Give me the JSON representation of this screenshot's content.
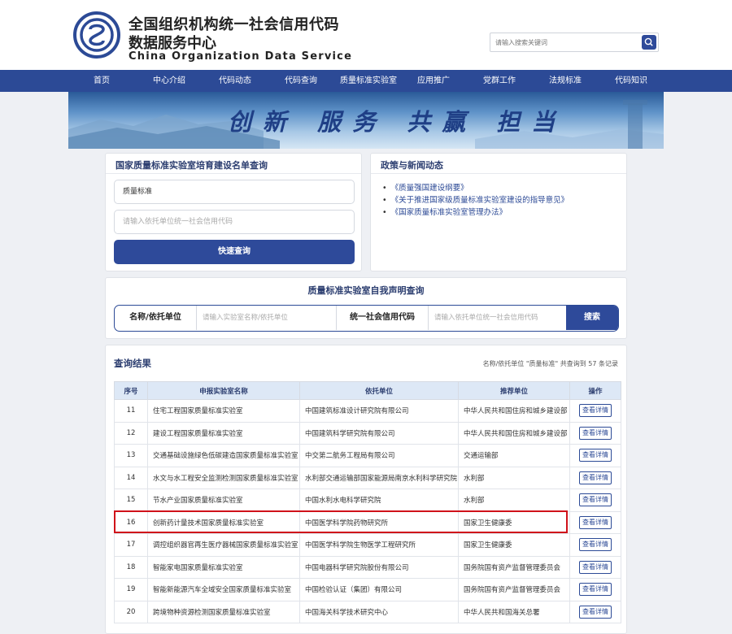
{
  "header": {
    "title_line1": "全国组织机构统一社会信用代码",
    "title_line2": "数据服务中心",
    "title_en": "China Organization Data Service",
    "search_placeholder": "请输入搜索关键词"
  },
  "nav": {
    "items": [
      "首页",
      "中心介绍",
      "代码动态",
      "代码查询",
      "质量标准实验室",
      "应用推广",
      "党群工作",
      "法规标准",
      "代码知识"
    ]
  },
  "banner": {
    "slogan": "创新 服务 共赢 担当"
  },
  "lab_query": {
    "title": "国家质量标准实验室培育建设名单查询",
    "name_value": "质量标准",
    "code_placeholder": "请输入依托单位统一社会信用代码",
    "submit_label": "快速查询"
  },
  "news": {
    "title": "政策与新闻动态",
    "items": [
      "《质量强国建设纲要》",
      "《关于推进国家级质量标准实验室建设的指导意见》",
      "《国家质量标准实验室管理办法》"
    ]
  },
  "self_declare": {
    "title": "质量标准实验室自我声明查询",
    "name_label": "名称/依托单位",
    "name_placeholder": "请输入实验室名称/依托单位",
    "code_label": "统一社会信用代码",
    "code_placeholder": "请输入依托单位统一社会信用代码",
    "search_label": "搜索"
  },
  "results": {
    "title": "查询结果",
    "summary": "名称/依托单位 \"质量标准\" 共查询到 57 条记录",
    "columns": [
      "序号",
      "申报实验室名称",
      "依托单位",
      "推荐单位",
      "操作"
    ],
    "detail_label": "查看详情",
    "rows": [
      {
        "no": "11",
        "name": "住宅工程国家质量标准实验室",
        "org": "中国建筑标准设计研究院有限公司",
        "recommender": "中华人民共和国住房和城乡建设部"
      },
      {
        "no": "12",
        "name": "建设工程国家质量标准实验室",
        "org": "中国建筑科学研究院有限公司",
        "recommender": "中华人民共和国住房和城乡建设部"
      },
      {
        "no": "13",
        "name": "交通基础设施绿色低碳建造国家质量标准实验室",
        "org": "中交第二航务工程局有限公司",
        "recommender": "交通运输部"
      },
      {
        "no": "14",
        "name": "水文与水工程安全监测检测国家质量标准实验室",
        "org": "水利部交通运输部国家能源局南京水利科学研究院",
        "recommender": "水利部"
      },
      {
        "no": "15",
        "name": "节水产业国家质量标准实验室",
        "org": "中国水利水电科学研究院",
        "recommender": "水利部"
      },
      {
        "no": "16",
        "name": "创新药计量技术国家质量标准实验室",
        "org": "中国医学科学院药物研究所",
        "recommender": "国家卫生健康委"
      },
      {
        "no": "17",
        "name": "调控组织器官再生医疗器械国家质量标准实验室",
        "org": "中国医学科学院生物医学工程研究所",
        "recommender": "国家卫生健康委"
      },
      {
        "no": "18",
        "name": "智能家电国家质量标准实验室",
        "org": "中国电器科学研究院股份有限公司",
        "recommender": "国务院国有资产监督管理委员会"
      },
      {
        "no": "19",
        "name": "智能新能源汽车全域安全国家质量标准实验室",
        "org": "中国检验认证（集团）有限公司",
        "recommender": "国务院国有资产监督管理委员会"
      },
      {
        "no": "20",
        "name": "跨境物种资源检测国家质量标准实验室",
        "org": "中国海关科学技术研究中心",
        "recommender": "中华人民共和国海关总署"
      }
    ]
  },
  "colors": {
    "primary": "#2c4a96",
    "highlight": "#d0121a",
    "header_bg": "#dde8f6"
  }
}
